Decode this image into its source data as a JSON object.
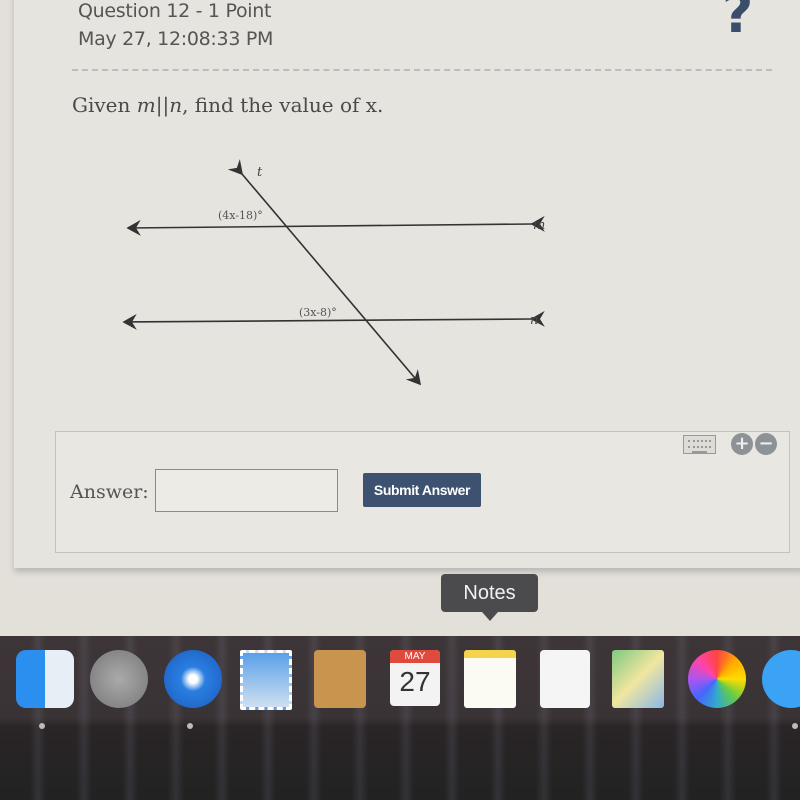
{
  "question": {
    "title": "Question 12 - 1 Point",
    "timestamp": "May 27, 12:08:33 PM",
    "help_icon": "question-mark-icon",
    "prompt_prefix": "Given ",
    "prompt_math": "m||n",
    "prompt_suffix": ", find the value of x."
  },
  "figure": {
    "transversal_label": "t",
    "line_top_label": "m",
    "line_bottom_label": "n",
    "angle_top": "(4x-18)°",
    "angle_bottom": "(3x-8)°"
  },
  "answer": {
    "label": "Answer:",
    "value": "",
    "placeholder": "",
    "submit_label": "Submit Answer",
    "keyboard_icon": "keyboard-icon",
    "zoom_in_icon": "plus-circle-icon",
    "zoom_out_icon": "minus-circle-icon"
  },
  "tooltip": {
    "text": "Notes"
  },
  "dock": {
    "items": [
      {
        "name": "Finder",
        "running": true
      },
      {
        "name": "Launchpad",
        "running": false
      },
      {
        "name": "Safari",
        "running": true
      },
      {
        "name": "Mail",
        "running": false
      },
      {
        "name": "Contacts",
        "running": false
      },
      {
        "name": "Calendar",
        "running": false,
        "month": "MAY",
        "day": "27"
      },
      {
        "name": "Notes",
        "running": false
      },
      {
        "name": "Reminders",
        "running": false
      },
      {
        "name": "Maps",
        "running": false
      },
      {
        "name": "Photos",
        "running": false
      },
      {
        "name": "Messages",
        "running": true
      }
    ]
  },
  "colors": {
    "accent": "#3c5270",
    "background": "#e6e4df",
    "dock": "#3a3335"
  }
}
